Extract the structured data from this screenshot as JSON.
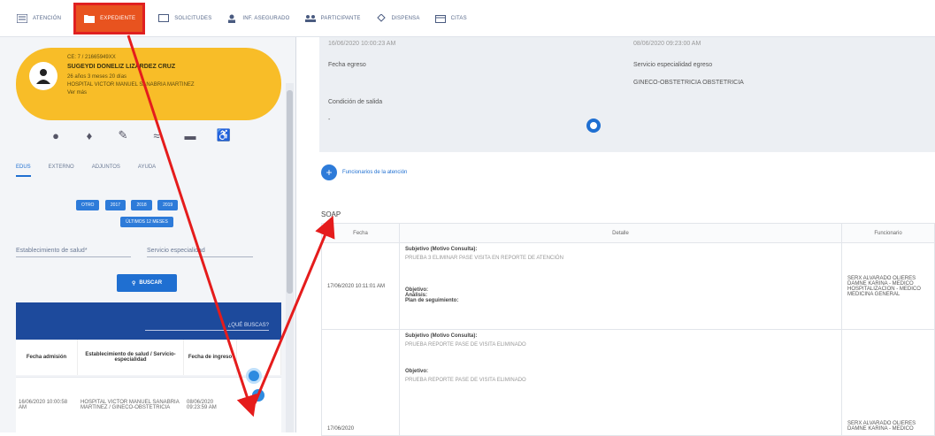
{
  "nav": {
    "tabs": [
      {
        "label": "ATENCIÓN",
        "icon": "list-icon",
        "active": false
      },
      {
        "label": "EXPEDIENTE",
        "icon": "folder-icon",
        "active": true
      },
      {
        "label": "SOLICITUDES",
        "icon": "monitor-icon",
        "active": false
      },
      {
        "label": "INF. ASEGURADO",
        "icon": "person-icon",
        "active": false
      },
      {
        "label": "PARTICIPANTE",
        "icon": "group-icon",
        "active": false
      },
      {
        "label": "DISPENSA",
        "icon": "dispense-icon",
        "active": false
      },
      {
        "label": "CITAS",
        "icon": "calendar-icon",
        "active": false
      }
    ],
    "active_color": "#e8531f"
  },
  "patient": {
    "id_line": "CE: 7 / 21665949XX",
    "name": "SUGEYDI DONELIZ LIZARDEZ CRUZ",
    "age": "26 años 3 meses 20 días",
    "hospital": "HOSPITAL VICTOR MANUEL SANABRIA MARTINEZ",
    "ver": "Ver más",
    "card_color": "#f8bd28"
  },
  "left": {
    "subtabs": [
      "EDUS",
      "EXTERNO",
      "ADJUNTOS",
      "AYUDA"
    ],
    "years": [
      "OTRO",
      "2017",
      "2018",
      "2019"
    ],
    "last_months": "ÚLTIMOS 12 MESES",
    "filter_establishment": "Establecimiento de salud*",
    "filter_service": "Servicio especialidad",
    "search_button": "BUSCAR",
    "table_search": "¿QUÉ BUSCAS?",
    "columns": [
      "Fecha admisión",
      "Establecimiento de salud / Servicio-especialidad",
      "Fecha de ingreso"
    ],
    "row": {
      "admission": "16/06/2020 10:00:58 AM",
      "establishment": "HOSPITAL VICTOR MANUEL SANABRIA MARTINEZ / GINECO-OBSTETRICIA",
      "ingress": "08/06/2020 09:23:59 AM"
    }
  },
  "right": {
    "top_date_left": "16/06/2020 10:00:23 AM",
    "top_date_right": "08/06/2020 09:23:00 AM",
    "fecha_egreso": "Fecha egreso",
    "servicio_egreso": "Servicio especialidad egreso",
    "servicio_value": "GINECO-OBSTETRICIA OBSTETRICIA",
    "condicion": "Condición de salida",
    "condicion_value": "-",
    "funcionarios": "Funcionarios de la atención",
    "soap_title": "SOAP",
    "soap_cols": [
      "Fecha",
      "Detalle",
      "Funcionario"
    ],
    "soap_rows": [
      {
        "fecha": "17/06/2020 10:11:01 AM",
        "subjetivo_label": "Subjetivo (Motivo Consulta):",
        "subjetivo": "PRUEBA 3 ELIMINAR PASE VISITA EN REPORTE DE ATENCIÓN",
        "objetivo": "Objetivo:",
        "analisis": "Análisis:",
        "plan": "Plan de seguimiento:",
        "funcionario": "SERX ALVARADO OLIERES DAMNE KARINA - MEDICO HOSPITALIZACION - MEDICO MEDICINA GENERAL"
      },
      {
        "fecha": "17/06/2020",
        "subjetivo_label": "Subjetivo (Motivo Consulta):",
        "subjetivo": "PRUEBA REPORTE PASE DE VISITA ELIMINADO",
        "objetivo": "Objetivo:",
        "objetivo_value": "PRUEBA REPORTE PASE DE VISITA ELIMINADO",
        "funcionario": "SERX ALVARADO OLIERES DAMNE KARINA - MEDICO"
      }
    ]
  }
}
